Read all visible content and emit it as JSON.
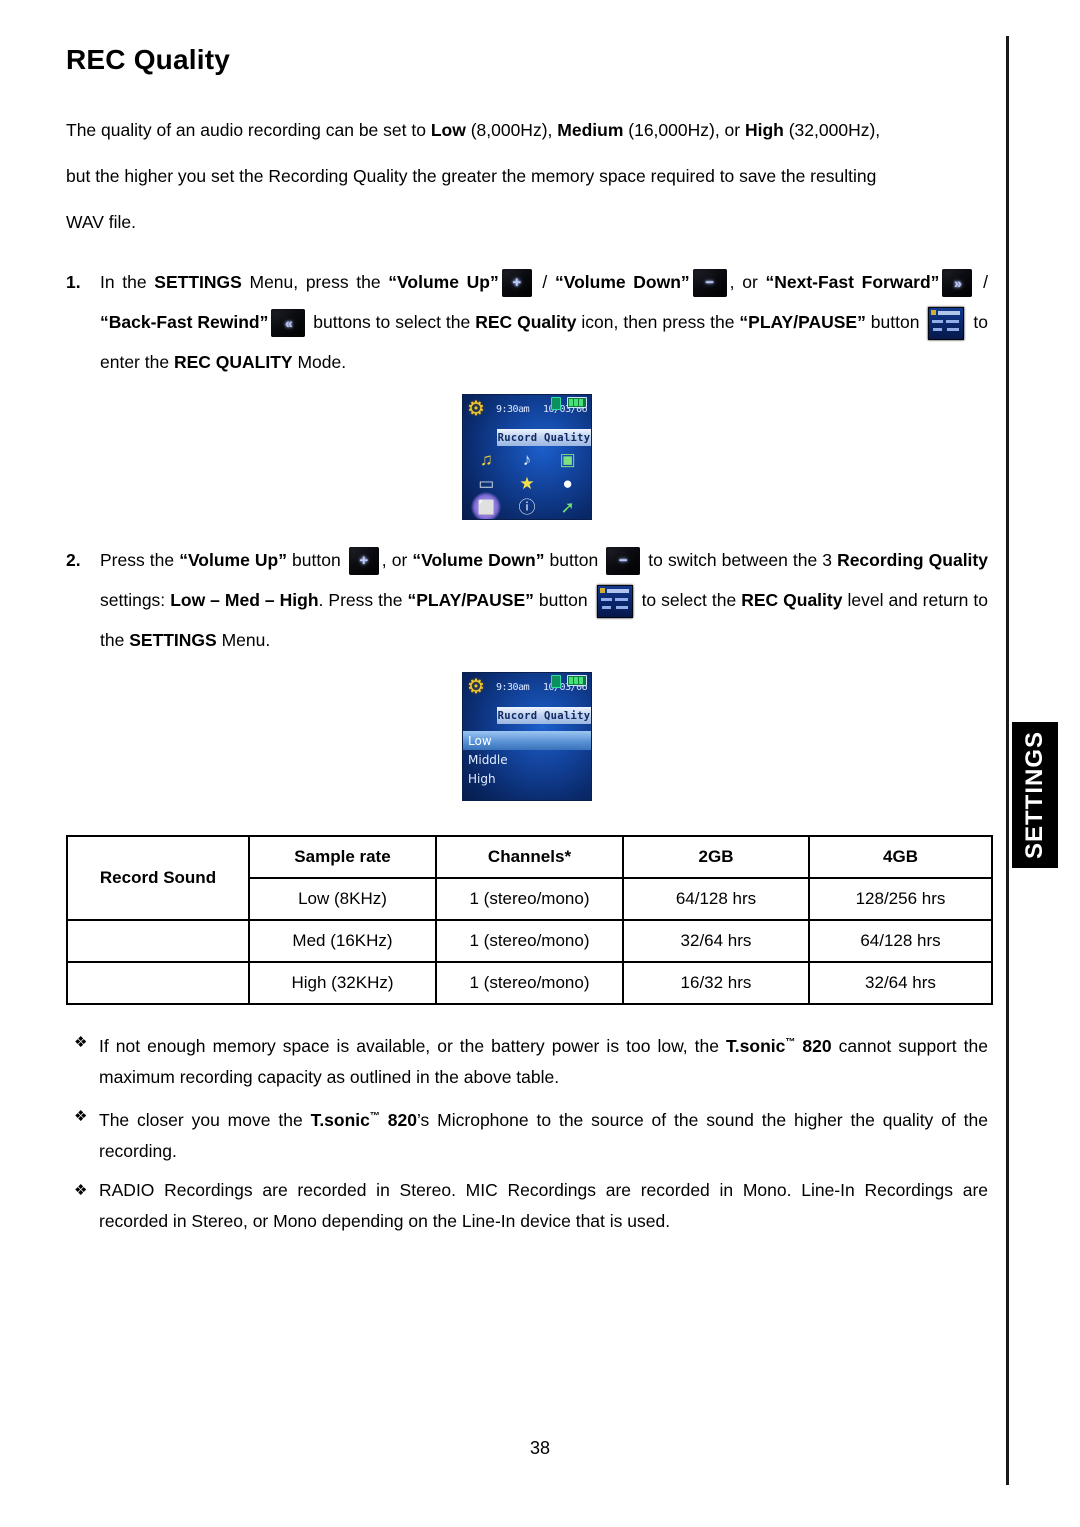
{
  "document": {
    "page_number": "38",
    "section_tab_label": "SETTINGS",
    "title": "REC Quality"
  },
  "intro": {
    "p1_a": "The quality of an audio recording can be set to ",
    "p1_low": "Low",
    "p1_b": " (8,000Hz), ",
    "p1_medium": "Medium",
    "p1_c": " (16,000Hz), or ",
    "p1_high": "High",
    "p1_d": " (32,000Hz),",
    "p2": "but the higher you set the Recording Quality the greater the memory space required to save the resulting",
    "p3": "WAV file."
  },
  "steps": [
    {
      "number": "1.",
      "seg1": "In the ",
      "b_settings": "SETTINGS",
      "seg2": " Menu, press the ",
      "b_volup": "“Volume Up”",
      "seg3": " / ",
      "b_voldown": "“Volume Down”",
      "seg4": ", or ",
      "b_nextff": "“Next-Fast Forward”",
      "seg5": " / ",
      "b_backrew": "“Back-Fast Rewind”",
      "seg6": " buttons to select the ",
      "b_recquality": "REC Quality",
      "seg7": " icon, then press the ",
      "b_playpause": "“PLAY/PAUSE”",
      "seg8": " button ",
      "seg9": " to enter the ",
      "b_recqualitymode": "REC QUALITY",
      "seg10": " Mode."
    },
    {
      "number": "2.",
      "seg1": "Press the ",
      "b_volup": "“Volume Up”",
      "seg2": " button ",
      "seg3": ", or ",
      "b_voldown": "“Volume Down”",
      "seg4": " button ",
      "seg5": " to switch between the 3",
      "b_recordingquality": "Recording Quality",
      "seg6": " settings: ",
      "b_levels": "Low – Med – High",
      "seg7": ". Press the ",
      "b_playpause": "“PLAY/PAUSE”",
      "seg8": " button ",
      "seg9": " to select the ",
      "b_recquality": "REC Quality",
      "seg10": " level and return to the ",
      "b_settings": "SETTINGS",
      "seg11": " Menu."
    }
  ],
  "device_menu_screen": {
    "clock": "9:30am",
    "date": "10/03/06",
    "title": "Rucord Quality",
    "gear_icon": "gear-wrench-icon",
    "lock_icon": "lock-icon",
    "battery_icon": "battery-icon",
    "icons": [
      {
        "name": "music-note-icon",
        "glyph": "♫",
        "color": "#f2d13a",
        "selected": false
      },
      {
        "name": "playlist-icon",
        "glyph": "♪",
        "color": "#dfe8f6",
        "selected": false
      },
      {
        "name": "photo-icon",
        "glyph": "▣",
        "color": "#7fe07f",
        "selected": false
      },
      {
        "name": "display-icon",
        "glyph": "▭",
        "color": "#cfd8e6",
        "selected": false
      },
      {
        "name": "favorites-file-icon",
        "glyph": "★",
        "color": "#f3e04a",
        "selected": false
      },
      {
        "name": "disc-tools-icon",
        "glyph": "●",
        "color": "#ffffff",
        "selected": false
      },
      {
        "name": "microphone-record-icon",
        "glyph": "⬜",
        "color": "#8ef0c4",
        "selected": true
      },
      {
        "name": "info-icon",
        "glyph": "ⓘ",
        "color": "#e6eefc",
        "selected": false
      },
      {
        "name": "exit-running-icon",
        "glyph": "➚",
        "color": "#6fe06f",
        "selected": false
      }
    ]
  },
  "device_list_screen": {
    "clock": "9:30am",
    "date": "10/03/06",
    "title": "Rucord Quality",
    "options": [
      {
        "label": "Low",
        "selected": true
      },
      {
        "label": "Middle",
        "selected": false
      },
      {
        "label": "High",
        "selected": false
      }
    ]
  },
  "spec_table": {
    "row_header": "Record Sound",
    "columns": [
      "",
      "Sample rate",
      "Channels*",
      "2GB",
      "4GB"
    ],
    "rows": [
      {
        "sample_rate": "Low (8KHz)",
        "channels": "1 (stereo/mono)",
        "gb2": "64/128 hrs",
        "gb4": "128/256 hrs"
      },
      {
        "sample_rate": "Med (16KHz)",
        "channels": "1 (stereo/mono)",
        "gb2": "32/64 hrs",
        "gb4": "64/128 hrs"
      },
      {
        "sample_rate": "High (32KHz)",
        "channels": "1 (stereo/mono)",
        "gb2": "16/32 hrs",
        "gb4": "32/64 hrs"
      }
    ]
  },
  "notes": {
    "marker": "❖",
    "n1_a": "If not enough memory space is available, or the battery power is too low, the ",
    "n1_brand": "T.sonic",
    "n1_tm": "™",
    "n1_model": " 820",
    "n1_b": " cannot",
    "n1_line2": "support the maximum recording capacity as outlined in the above table.",
    "n2_a": "The closer you move the ",
    "n2_brand": "T.sonic",
    "n2_tm": "™",
    "n2_model": " 820",
    "n2_b": "’s Microphone to the source of the sound the higher the quality",
    "n2_line2": "of the recording.",
    "n3_line1": "RADIO Recordings are recorded in Stereo. MIC Recordings are recorded in Mono. Line-In",
    "n3_line2": "Recordings are recorded in Stereo, or Mono depending on the Line-In device that is used."
  },
  "inline_buttons": {
    "volume_up": {
      "name": "volume-up-button",
      "glyph": "+"
    },
    "volume_down": {
      "name": "volume-down-button",
      "glyph": "−"
    },
    "next_fast_forward": {
      "name": "next-fast-forward-button",
      "glyph": "»"
    },
    "back_fast_rewind": {
      "name": "back-fast-rewind-button",
      "glyph": "«"
    },
    "play_pause": {
      "name": "play-pause-button",
      "glyph": "lcd-thumbnail"
    }
  }
}
